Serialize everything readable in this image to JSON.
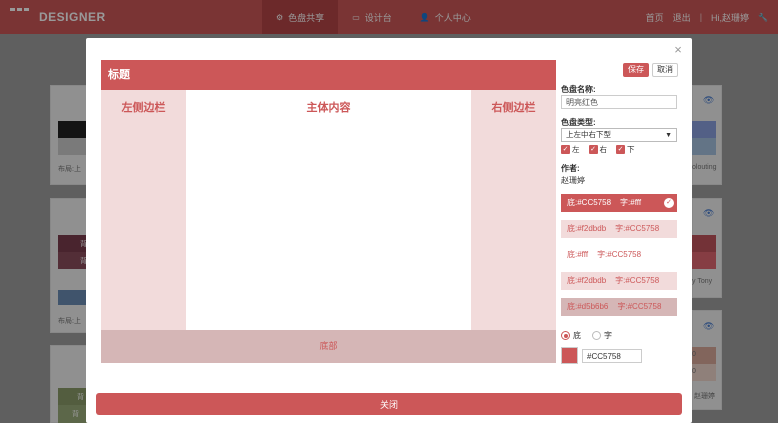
{
  "navbar": {
    "logo_text": "DESIGNER",
    "tabs": [
      {
        "label": "色盘共享",
        "icon": "gear-icon",
        "glyph": "⚙"
      },
      {
        "label": "设计台",
        "icon": "desk-icon",
        "glyph": "▭"
      },
      {
        "label": "个人中心",
        "icon": "user-icon",
        "glyph": "👤"
      }
    ],
    "home": "首页",
    "logout": "退出",
    "greeting": "Hi,赵珊婷",
    "wrench_glyph": "🔧"
  },
  "background": {
    "card1_caption": "布局:上",
    "card2_caption": "布局:上",
    "card_side_1": "olouting",
    "card_side_2": "y Tony",
    "card_side_3": "赵珊婷",
    "num1": "0",
    "num2": "0",
    "bg_chars": [
      "背",
      "背",
      "背",
      "背"
    ]
  },
  "modal": {
    "close_glyph": "×",
    "close_button": "关闭"
  },
  "preview": {
    "header_title": "标题",
    "left_title": "左侧边栏",
    "main_title": "主体内容",
    "right_title": "右侧边栏",
    "footer_title": "底部"
  },
  "panel": {
    "save": "保存",
    "cancel": "取消",
    "name_label": "色盘名称:",
    "name_value": "明亮红色",
    "type_label": "色盘类型:",
    "type_value": "上左中右下型",
    "checks": [
      {
        "label": "左",
        "checked": true
      },
      {
        "label": "右",
        "checked": true
      },
      {
        "label": "下",
        "checked": true
      }
    ],
    "author_label": "作者:",
    "author_name": "赵珊婷",
    "swatches": [
      {
        "bg_text": "底:#CC5758",
        "fg_text": "字:#fff",
        "bg": "#cc5758",
        "fg": "#ffffff",
        "selected": true
      },
      {
        "bg_text": "底:#f2dbdb",
        "fg_text": "字:#CC5758",
        "bg": "#f2dbdb",
        "fg": "#cc5758",
        "selected": false
      },
      {
        "bg_text": "底:#fff",
        "fg_text": "字:#CC5758",
        "bg": "#ffffff",
        "fg": "#cc5758",
        "selected": false
      },
      {
        "bg_text": "底:#f2dbdb",
        "fg_text": "字:#CC5758",
        "bg": "#f2dbdb",
        "fg": "#cc5758",
        "selected": false
      },
      {
        "bg_text": "底:#d5b6b6",
        "fg_text": "字:#CC5758",
        "bg": "#d5b6b6",
        "fg": "#cc5758",
        "selected": false
      }
    ],
    "radio_bg": "底",
    "radio_fg": "字",
    "radio_selected": "底",
    "hex_value": "#CC5758",
    "check_glyph": "✓"
  },
  "colors": {
    "accent": "#cc5758",
    "light": "#f2dbdb",
    "mid": "#d5b6b6"
  }
}
